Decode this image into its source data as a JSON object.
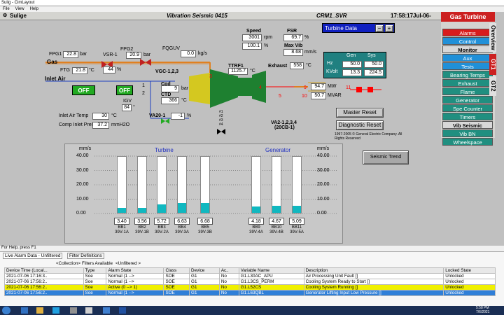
{
  "window": {
    "title": "Sulig - CimLayout",
    "menu": [
      "File",
      "View",
      "Help"
    ]
  },
  "header": {
    "site": "Sulige",
    "title": "Vibration Seismic 0415",
    "unit": "CRM1_SVR",
    "time": "17:58:17",
    "date": "Jul-06-2021"
  },
  "nav": {
    "title": "Gas Turbine",
    "items": [
      "Alarms",
      "Control",
      "Monitor",
      "Aux",
      "Tests",
      "Bearing Temps",
      "Exhaust",
      "Flame",
      "Generator",
      "Spe Counter",
      "Timers",
      "Vib Seismic",
      "Vib BN",
      "Wheelspace"
    ],
    "tab_gt1": "GT1",
    "tab_gt2": "GT2",
    "tab_overview": "Overview"
  },
  "turbine_select": {
    "label": "Turbine Data",
    "minus": "−",
    "plus": "+"
  },
  "process": {
    "fpg1": {
      "label": "FPG1",
      "value": "22.8",
      "unit": "bar"
    },
    "gas": "Gas",
    "ftg": {
      "label": "FTG",
      "value": "21.8",
      "unit": "°C"
    },
    "vsr": {
      "label": "VSR-1",
      "value": "44",
      "unit": "%"
    },
    "fpg2": {
      "label": "FPG2",
      "value": "20.9",
      "unit": "bar"
    },
    "fqguv": {
      "label": "FQGUV",
      "value": "0.0",
      "unit": "kg/s"
    },
    "vgc": "VGC-1,2,3",
    "speed": {
      "label": "Speed",
      "value": "3001",
      "unit": "rpm",
      "pct": "100.1",
      "pct_unit": "%"
    },
    "fsr": {
      "label": "FSR",
      "value": "69.7",
      "unit": "%"
    },
    "maxvib": {
      "label": "Max Vib",
      "value": "8.68",
      "unit": "mm/s"
    },
    "ttrf1": {
      "label": "TTRF1",
      "value": "1125.7",
      "unit": "°C"
    },
    "exhaust": {
      "label": "Exhaust",
      "value": "558",
      "unit": "°C"
    },
    "inlet_air": "Inlet Air",
    "off1": "OFF",
    "off2": "OFF",
    "cpd": {
      "label": "Cpd",
      "value": "9",
      "unit": "bar"
    },
    "ctd": {
      "label": "CTD",
      "value": "366",
      "unit": "°C"
    },
    "igv": {
      "label": "IGV",
      "value": "84",
      "unit": "°"
    },
    "va20": {
      "label": "VA20-1",
      "value": "-1",
      "unit": "%"
    },
    "inlet_temp": {
      "label": "Inlet Air Temp",
      "value": "30",
      "unit": "°C"
    },
    "comp_inlet": {
      "label": "Comp Inlet Pres",
      "value": "37.2",
      "unit": "mmH2O"
    },
    "va2": "VA2-1,2,3,4",
    "va2b": "(20CB-1)",
    "markers": [
      "#1",
      "#2",
      "#3",
      "#4"
    ],
    "mw": {
      "value": "94.7",
      "unit": "MW"
    },
    "mvar": {
      "value": "50.7",
      "unit": "MVAR"
    },
    "genSys": {
      "gen": "Gen",
      "sys": "Sys",
      "hz": "Hz",
      "hz_gen": "50.0",
      "hz_sys": "50.0",
      "kv": "KVolt",
      "kv_gen": "13.3",
      "kv_sys": "224.5"
    },
    "nums": [
      "1",
      "2",
      "3",
      "4",
      "5",
      "9",
      "10",
      "11"
    ]
  },
  "buttons": {
    "master_reset": "Master Reset",
    "diagnostic_reset": "Diagnostic Reset",
    "seismic_trend": "Seismic Trend"
  },
  "copyright": "1997-2005 © General Electric Company. All Rights Reserved",
  "chart_data": [
    {
      "type": "bar",
      "title": "Turbine",
      "ylabel": "mm/s",
      "ylim": [
        0,
        40
      ],
      "yticks": [
        "40.00",
        "30.00",
        "20.00",
        "10.00",
        "0.00"
      ],
      "categories": [
        "BB1",
        "BB2",
        "BB3",
        "BB4",
        "BB5"
      ],
      "sublabels": [
        "39V-1A",
        "39V-1B",
        "39V-2A",
        "39V-3A",
        "39V-3B"
      ],
      "values": [
        3.4,
        3.56,
        5.72,
        6.63,
        6.68
      ],
      "labels": [
        "3.40",
        "3.56",
        "5.72",
        "6.63",
        "6.68"
      ]
    },
    {
      "type": "bar",
      "title": "Generator",
      "ylabel": "mm/s",
      "ylim": [
        0,
        40
      ],
      "yticks": [
        "40.00",
        "30.00",
        "20.00",
        "10.00",
        "0.00"
      ],
      "categories": [
        "BB9",
        "BB10",
        "BB11"
      ],
      "sublabels": [
        "39V-4A",
        "39V-4B",
        "39V-5A"
      ],
      "values": [
        4.18,
        4.67,
        5.09
      ],
      "labels": [
        "4.18",
        "4.67",
        "5.09"
      ]
    }
  ],
  "status": "For Help, press F1",
  "alarms": {
    "tab1": "Live Alarm Data - Unfiltered",
    "tab2": "Filter Definitions",
    "collection": "<Collection>",
    "filters": "Filters Available",
    "unfiltered": "<Unfiltered >",
    "columns": [
      "Device Time (Local...",
      "Type",
      "Alarm State",
      "Class",
      "Device",
      "Ac..",
      "Variable Name",
      "Description",
      "Locked State"
    ],
    "rows": [
      [
        "2021-07-06 17:16:3..",
        "Soe",
        "Normal (1 -->",
        "SOE",
        "G1",
        "No",
        "G1.L30AC_APU",
        "Air Processing Unit Fault []",
        "Unlocked"
      ],
      [
        "2021-07-06 17:56:2..",
        "Soe",
        "Normal (1 -->",
        "SOE",
        "G1",
        "No",
        "G1.L3CS_PERM",
        "Cooling System Ready to Start []",
        "Unlocked"
      ],
      [
        "2021-07-06 17:56:2..",
        "Soe",
        "Active (0 --> 1)",
        "SOE",
        "G1",
        "No",
        "G1.L52CS",
        "Cooling System Running []",
        "Unlocked"
      ],
      [
        "2021-07-06 17:56:2..",
        "Soe",
        "Normal (1 -->",
        "SOE",
        "G1",
        "No",
        "G1.L63QBL",
        "Generator Lifting Input Low Pressure []",
        "Unlocked"
      ]
    ]
  },
  "taskbar": {
    "time": "5:58 PM",
    "date": "7/6/2021"
  }
}
